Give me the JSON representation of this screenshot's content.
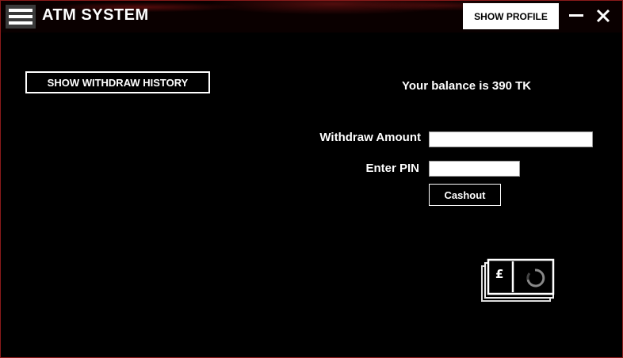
{
  "titlebar": {
    "app_title": "ATM SYSTEM",
    "menu_icon": "hamburger-menu-icon",
    "show_profile_label": "SHOW PROFILE",
    "minimize_icon": "minimize-icon",
    "close_icon": "close-icon"
  },
  "main": {
    "withdraw_history_label": "SHOW WITHDRAW HISTORY",
    "balance_text": "Your balance is 390 TK",
    "withdraw_amount_label": "Withdraw Amount",
    "withdraw_amount_value": "",
    "pin_label": "Enter PIN",
    "pin_value": "",
    "cashout_label": "Cashout",
    "money_icon": "cash-pound-icon"
  },
  "colors": {
    "background": "#000000",
    "titlebar_accent": "#8b1a1a",
    "text": "#ffffff"
  }
}
